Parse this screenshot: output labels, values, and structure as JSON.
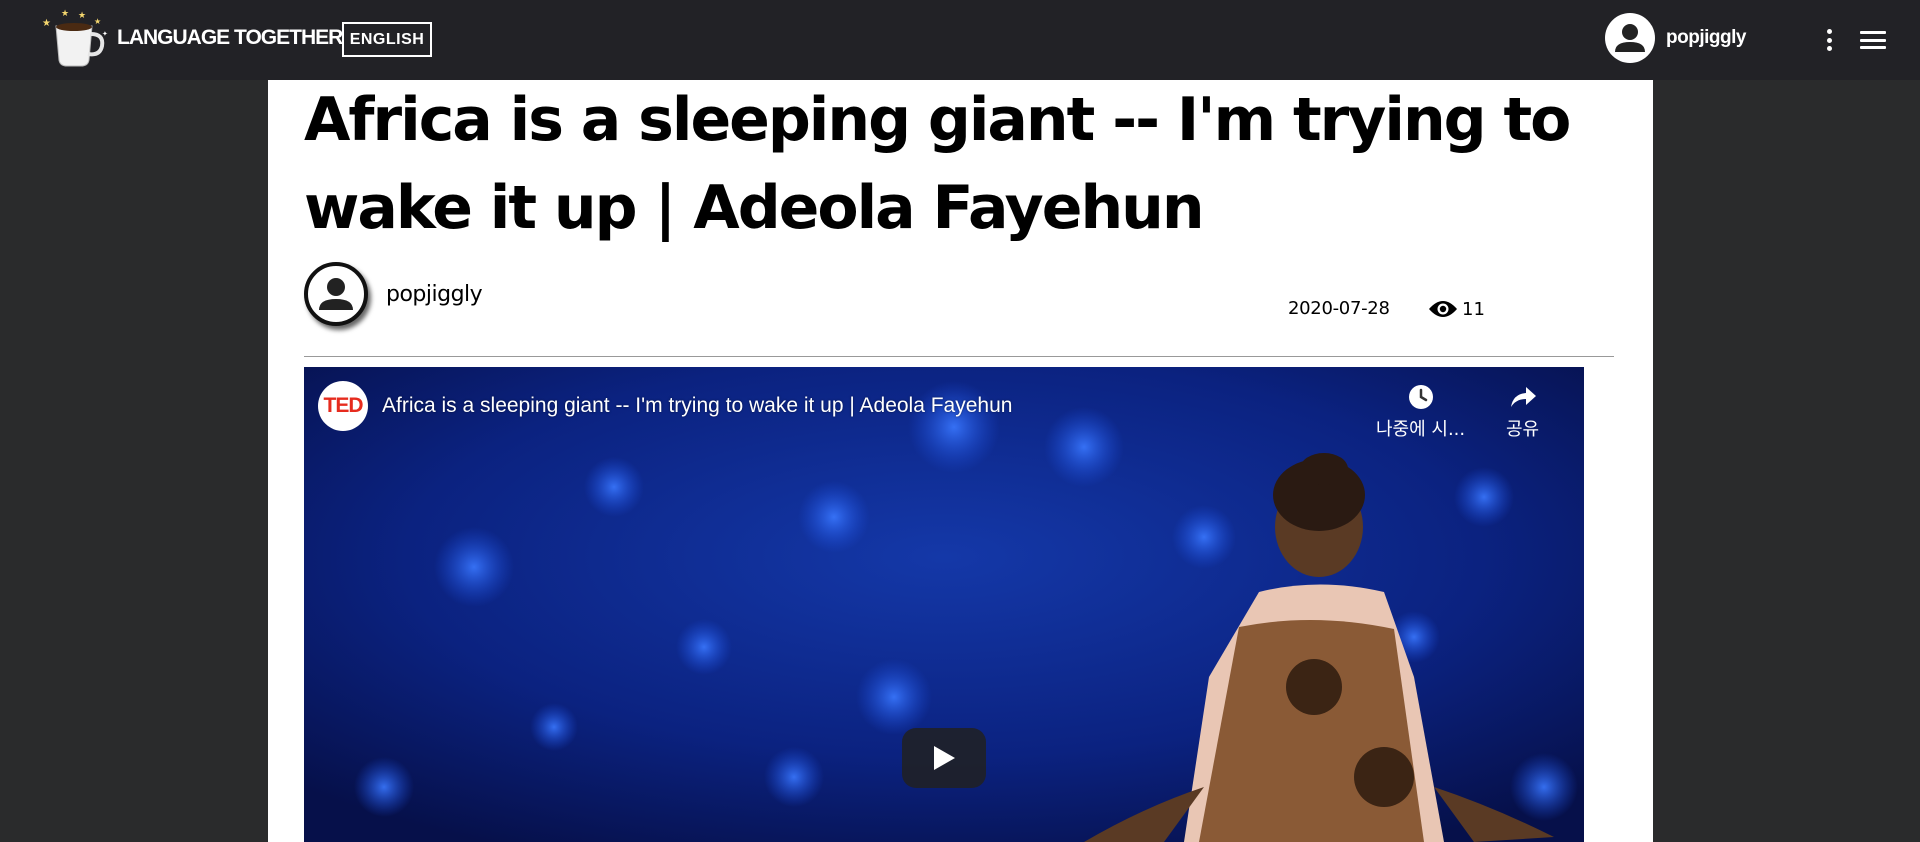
{
  "nav": {
    "brand": "LANGUAGE TOGETHER",
    "language": "ENGLISH",
    "username": "popjiggly"
  },
  "article": {
    "title": "Africa is a sleeping giant -- I'm trying to wake it up | Adeola Fayehun",
    "author": "popjiggly",
    "date": "2020-07-28",
    "views": "11"
  },
  "video": {
    "channel_logo": "TED",
    "title": "Africa is a sleeping giant -- I'm trying to wake it up | Adeola Fayehun",
    "watch_later_label": "나중에 시...",
    "share_label": "공유"
  },
  "colors": {
    "topbar": "#222226",
    "page_bg": "#2a2b2c",
    "ted_red": "#e62b1e",
    "video_bg": "#0a1a5c"
  }
}
